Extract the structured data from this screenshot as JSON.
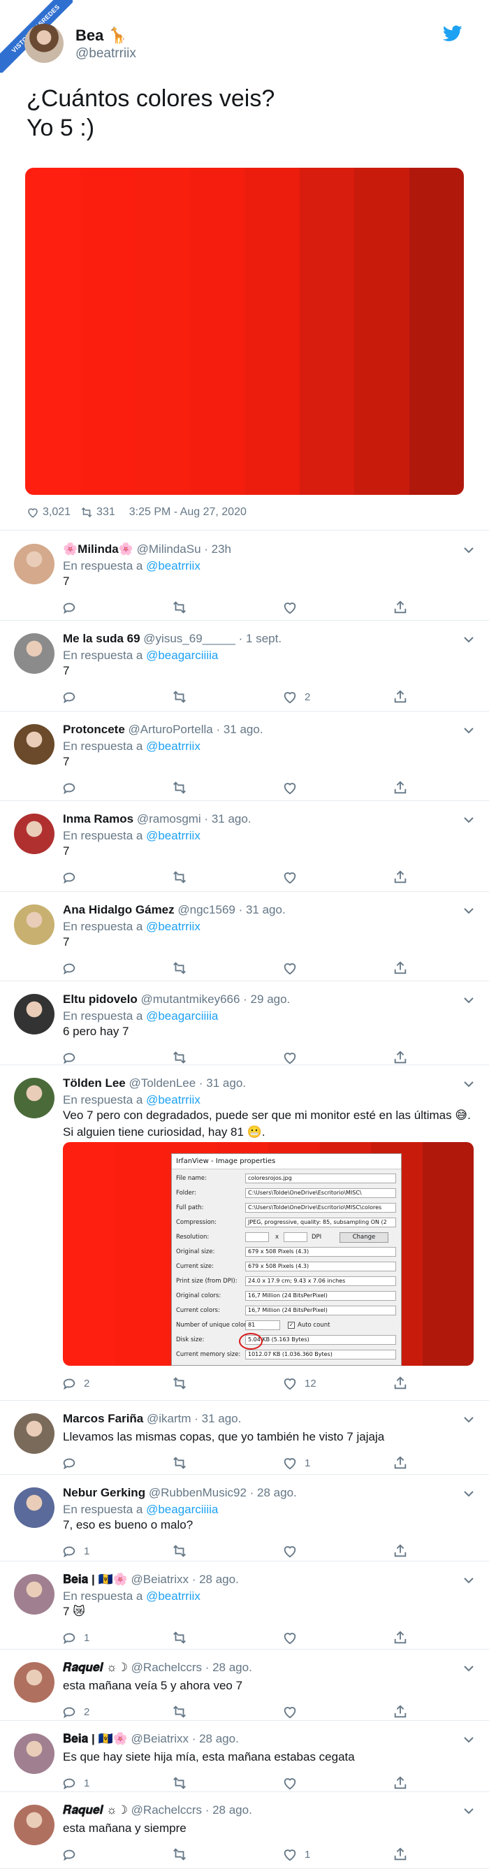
{
  "watermark": "VISTOENLASREDES",
  "main_tweet": {
    "name": "Bea",
    "emoji": "🦒",
    "handle": "@beatrriix",
    "text_line1": "¿Cuántos colores veis?",
    "text_line2": "Yo 5 :)",
    "swatch_colors": [
      "#ff1f10",
      "#fb1e0f",
      "#f91f0f",
      "#f51e0e",
      "#ec1d0d",
      "#d81d0e",
      "#c91b0c",
      "#b0180c"
    ],
    "likes": "3,021",
    "retweets": "331",
    "timestamp": "3:25 PM - Aug 27, 2020"
  },
  "reply_prefix": "En respuesta a",
  "replies": [
    {
      "name": "🌸Milinda🌸",
      "handle": "@MilindaSu · 23h",
      "reply_to": "@beatrriix",
      "text": "7",
      "replies": "",
      "likes": "",
      "avatar": "#d4a98c"
    },
    {
      "name": "Me la suda 69",
      "handle": "@yisus_69_____ · 1 sept.",
      "reply_to": "@beagarciiiia",
      "text": "7",
      "replies": "",
      "likes": "2",
      "avatar": "#8b8b8b"
    },
    {
      "name": "Protoncete",
      "handle": "@ArturoPortella · 31 ago.",
      "reply_to": "@beatrriix",
      "text": "7",
      "replies": "",
      "likes": "",
      "avatar": "#6a4a2a"
    },
    {
      "name": "Inma Ramos",
      "handle": "@ramosgmi · 31 ago.",
      "reply_to": "@beatrriix",
      "text": "7",
      "replies": "",
      "likes": "",
      "avatar": "#b03030"
    },
    {
      "name": "Ana Hidalgo Gámez",
      "handle": "@ngc1569 · 31 ago.",
      "reply_to": "@beatrriix",
      "text": "7",
      "replies": "",
      "likes": "",
      "avatar": "#c8b070"
    },
    {
      "name": "Eltu pidovelo",
      "handle": "@mutantmikey666 · 29 ago.",
      "reply_to": "@beagarciiiia",
      "text": "6 pero hay 7",
      "replies": "",
      "likes": "",
      "avatar": "#333333"
    },
    {
      "name": "Tölden Lee",
      "handle": "@ToldenLee · 31 ago.",
      "reply_to": "@beatrriix",
      "text": "Veo 7 pero con degradados, puede ser que mi monitor esté en las últimas 😅. Si alguien tiene curiosidad, hay 81 😬.",
      "replies": "2",
      "likes": "12",
      "avatar": "#4b6a3a"
    },
    {
      "name": "Marcos Fariña",
      "handle": "@ikartm · 31 ago.",
      "reply_to": "",
      "text": "Llevamos las mismas copas, que yo también he visto 7 jajaja",
      "replies": "",
      "likes": "1",
      "avatar": "#7a6a5a"
    },
    {
      "name": "Nebur Gerking",
      "handle": "@RubbenMusic92 · 28 ago.",
      "reply_to": "@beagarciiiia",
      "text": "7, eso es bueno o malo?",
      "replies": "1",
      "likes": "",
      "avatar": "#5a6a9a"
    },
    {
      "name": "𝐁𝐞𝐢𝐚 | 🇧🇧🌸",
      "handle": "@Beiatrixx · 28 ago.",
      "reply_to": "@beatrriix",
      "text": "7 😿",
      "replies": "1",
      "likes": "",
      "avatar": "#a08090"
    },
    {
      "name": "𝑹𝒂𝒒𝒖𝒆𝒍 ☼☽",
      "handle": "@Rachelccrs · 28 ago.",
      "reply_to": "",
      "text": "esta mañana veía 5 y ahora veo 7",
      "replies": "2",
      "likes": "",
      "avatar": "#b07060"
    },
    {
      "name": "𝐁𝐞𝐢𝐚 | 🇧🇧🌸",
      "handle": "@Beiatrixx · 28 ago.",
      "reply_to": "",
      "text": "Es que hay siete hija mía, esta mañana estabas cegata",
      "replies": "1",
      "likes": "",
      "avatar": "#a08090"
    },
    {
      "name": "𝑹𝒂𝒒𝒖𝒆𝒍 ☼☽",
      "handle": "@Rachelccrs · 28 ago.",
      "reply_to": "",
      "text": "esta mañana y siempre",
      "replies": "",
      "likes": "1",
      "avatar": "#b07060"
    }
  ],
  "irfanview": {
    "title": "IrfanView - Image properties",
    "rows": [
      {
        "label": "File name:",
        "value": "coloresrojos.jpg"
      },
      {
        "label": "Folder:",
        "value": "C:\\Users\\Tolde\\OneDrive\\Escritorio\\MISC\\"
      },
      {
        "label": "Full path:",
        "value": "C:\\Users\\Tolde\\OneDrive\\Escritorio\\MISC\\colores"
      },
      {
        "label": "Compression:",
        "value": "JPEG, progressive, quality: 85, subsampling ON (2"
      },
      {
        "label": "Resolution:",
        "value": ""
      },
      {
        "label": "Original size:",
        "value": "679 x 508  Pixels (4.3)"
      },
      {
        "label": "Current size:",
        "value": "679 x 508  Pixels (4.3)"
      },
      {
        "label": "Print size (from DPI):",
        "value": "24.0 x 17.9 cm; 9.43 x 7.06 inches"
      },
      {
        "label": "Original colors:",
        "value": "16,7 Million   (24 BitsPerPixel)"
      },
      {
        "label": "Current colors:",
        "value": "16,7 Million   (24 BitsPerPixel)"
      },
      {
        "label": "Number of unique colors:",
        "value": "81"
      },
      {
        "label": "Disk size:",
        "value": "5.04 KB (5.163 Bytes)"
      },
      {
        "label": "Current memory size:",
        "value": "1012.07  KB (1.036.360 Bytes)"
      }
    ],
    "dpi_label": "DPI",
    "x_label": "x",
    "change_button": "Change",
    "auto_count": "Auto count"
  }
}
